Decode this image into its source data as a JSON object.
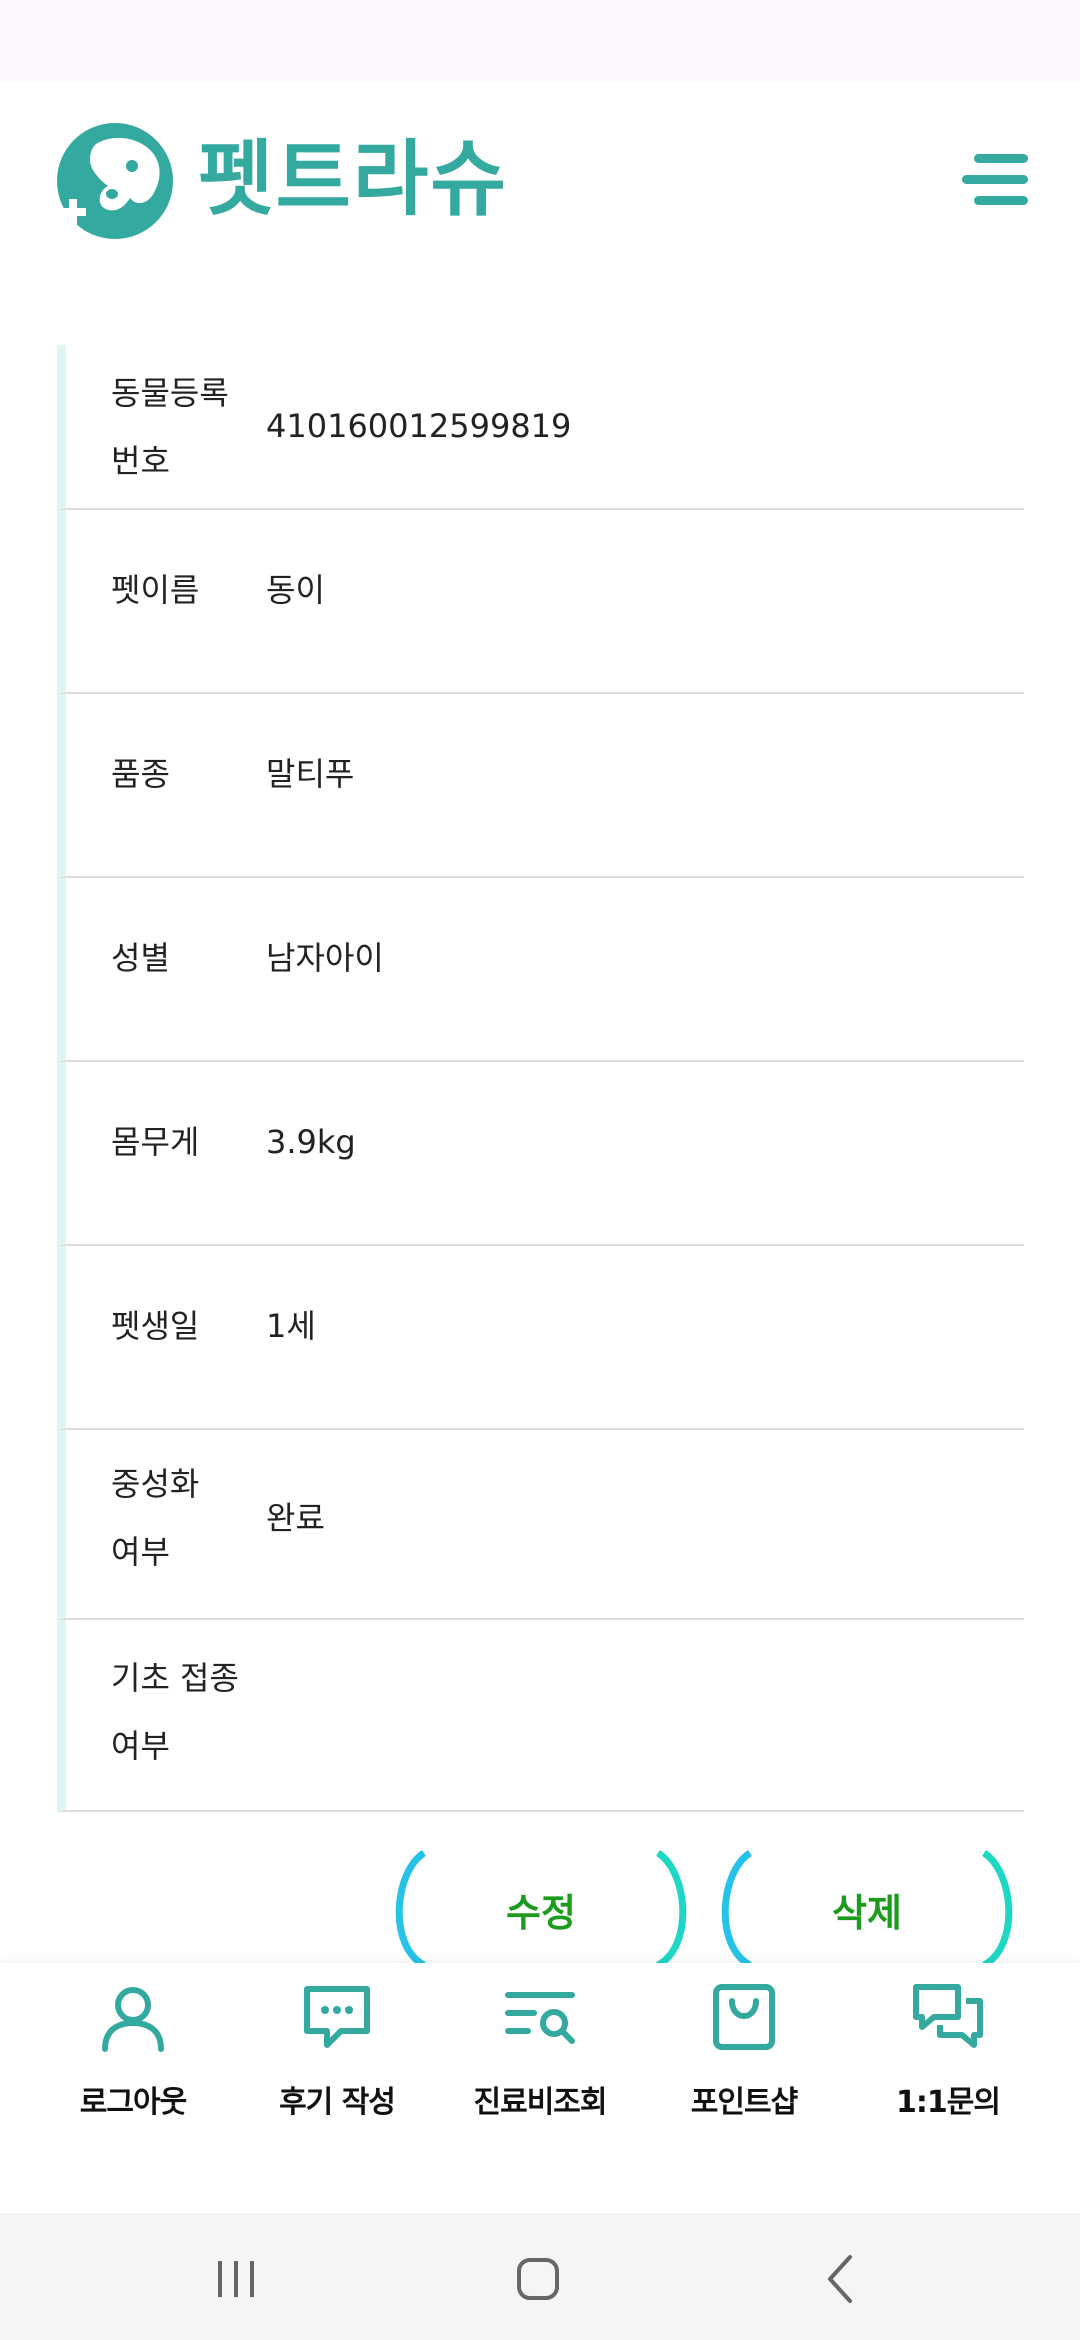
{
  "app": {
    "name": "펫트라슈",
    "brand_color": "#33a9a0",
    "icon": "pet-cross-logo-icon"
  },
  "header": {
    "menu_icon": "hamburger-menu-icon"
  },
  "pet_info": {
    "rows": [
      {
        "label": "동물등록\n번호",
        "value": "410160012599819"
      },
      {
        "label": "펫이름",
        "value": "동이"
      },
      {
        "label": "품종",
        "value": "말티푸"
      },
      {
        "label": "성별",
        "value": "남자아이"
      },
      {
        "label": "몸무게",
        "value": "3.9kg"
      },
      {
        "label": "펫생일",
        "value": "1세"
      },
      {
        "label": "중성화\n여부",
        "value": "완료"
      },
      {
        "label": "기초 접종\n여부",
        "value": ""
      }
    ]
  },
  "actions": {
    "edit_label": "수정",
    "delete_label": "삭제",
    "text_color": "#1c9b1f"
  },
  "bottom_nav": {
    "items": [
      {
        "label": "로그아웃",
        "icon": "user-icon"
      },
      {
        "label": "후기 작성",
        "icon": "chat-bubble-icon"
      },
      {
        "label": "진료비조회",
        "icon": "list-search-icon"
      },
      {
        "label": "포인트샵",
        "icon": "shopping-bag-icon"
      },
      {
        "label": "1:1문의",
        "icon": "chat-bubbles-icon"
      }
    ]
  },
  "system_nav": {
    "icons": [
      "recent-apps-icon",
      "home-icon",
      "back-icon"
    ]
  }
}
